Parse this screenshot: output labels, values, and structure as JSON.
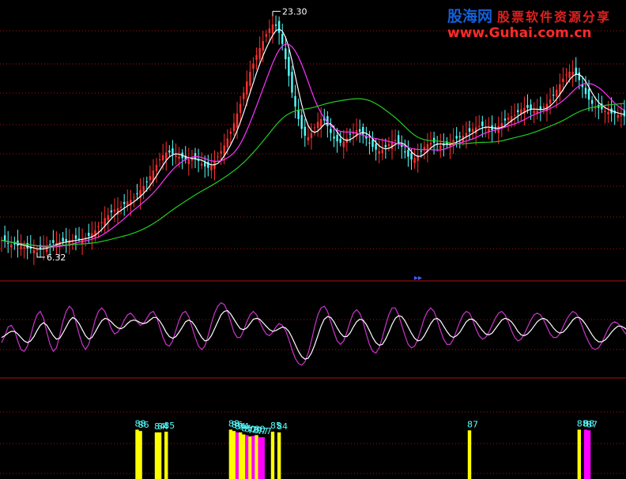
{
  "watermark": {
    "brand": "股海网",
    "tagline": "股票软件资源分享",
    "url": "www.Guhai.com.cn"
  },
  "colors": {
    "background": "#000000",
    "candle_up": "#ff3030",
    "candle_down": "#55ffff",
    "ma_short": "#ffffff",
    "ma_mid": "#ff33ff",
    "ma_long": "#22cc22",
    "kd_k": "#cc33cc",
    "kd_d": "#ffffff",
    "kd_j": "#ffff66",
    "divider": "#b01010",
    "grid_dots": "#b01010",
    "bar_yellow": "#ffff00",
    "bar_magenta": "#ff00ff",
    "bar_label": "#55ffff",
    "extreme_label": "#ffffff"
  },
  "chart_data": [
    {
      "type": "candlestick",
      "panel": "price",
      "x": [
        0,
        1,
        2,
        3,
        4,
        5,
        6,
        7,
        8,
        9,
        10,
        11,
        12,
        13,
        14,
        15,
        16,
        17,
        18,
        19,
        20,
        21,
        22,
        23,
        24,
        25,
        26,
        27,
        28,
        29,
        30,
        31,
        32,
        33,
        34,
        35,
        36,
        37,
        38,
        39,
        40,
        41,
        42,
        43,
        44,
        45,
        46,
        47,
        48,
        49,
        50,
        51,
        52,
        53,
        54,
        55,
        56,
        57,
        58,
        59,
        60,
        61,
        62,
        63,
        64,
        65,
        66,
        67,
        68,
        69,
        70,
        71,
        72,
        73,
        74,
        75,
        76,
        77,
        78,
        79,
        80,
        81,
        82,
        83,
        84,
        85,
        86,
        87,
        88,
        89,
        90,
        91,
        92,
        93,
        94,
        95,
        96,
        97,
        98,
        99,
        100,
        101,
        102,
        103,
        104,
        105,
        106,
        107,
        108,
        109,
        110,
        111,
        112,
        113,
        114,
        115,
        116,
        117,
        118,
        119,
        120,
        121,
        122,
        123,
        124,
        125,
        126,
        127,
        128,
        129,
        130,
        131,
        132,
        133,
        134,
        135,
        136,
        137,
        138,
        139,
        140,
        141,
        142,
        143,
        144,
        145,
        146,
        147,
        148,
        149,
        150,
        151,
        152,
        153,
        154,
        155,
        156,
        157,
        158,
        159,
        160,
        161,
        162,
        163,
        164,
        165,
        166,
        167,
        168,
        169,
        170,
        171,
        172,
        173,
        174,
        175,
        176,
        177,
        178,
        179,
        180,
        181,
        182,
        183,
        184,
        185,
        186,
        187,
        188,
        189,
        190,
        191,
        192,
        193,
        194,
        195,
        196,
        197
      ],
      "close": [
        7.2,
        7.1,
        7.0,
        6.9,
        6.9,
        6.8,
        6.8,
        6.7,
        6.6,
        6.6,
        6.5,
        6.5,
        6.6,
        6.7,
        6.8,
        6.9,
        7.0,
        7.0,
        7.1,
        7.1,
        7.1,
        7.2,
        7.2,
        7.3,
        7.3,
        7.3,
        7.4,
        7.5,
        7.7,
        7.9,
        8.2,
        8.5,
        8.8,
        9.0,
        9.2,
        9.4,
        9.5,
        9.6,
        9.8,
        10.0,
        10.1,
        10.3,
        10.5,
        10.8,
        11.1,
        11.4,
        11.8,
        12.2,
        12.6,
        13.0,
        13.3,
        13.5,
        13.5,
        13.4,
        13.3,
        13.2,
        13.1,
        13.0,
        13.0,
        13.1,
        13.0,
        12.9,
        12.7,
        12.5,
        12.4,
        12.6,
        12.9,
        13.2,
        13.6,
        14.0,
        14.5,
        15.0,
        15.6,
        16.3,
        17.0,
        17.8,
        18.6,
        19.3,
        19.9,
        20.5,
        21.0,
        21.5,
        22.0,
        22.4,
        22.7,
        22.6,
        22.1,
        21.3,
        20.2,
        19.0,
        17.8,
        16.8,
        15.9,
        15.2,
        14.7,
        14.6,
        14.9,
        15.3,
        15.7,
        15.9,
        15.8,
        15.4,
        14.9,
        14.5,
        14.3,
        14.2,
        14.3,
        14.5,
        14.8,
        15.0,
        15.1,
        15.0,
        14.8,
        14.5,
        14.2,
        13.9,
        13.7,
        13.6,
        13.7,
        13.9,
        14.1,
        14.3,
        14.4,
        14.2,
        13.9,
        13.5,
        13.2,
        13.0,
        13.1,
        13.3,
        13.6,
        13.9,
        14.1,
        14.2,
        14.2,
        14.1,
        14.0,
        14.0,
        14.1,
        14.2,
        14.4,
        14.5,
        14.6,
        14.7,
        14.9,
        15.0,
        15.2,
        15.3,
        15.4,
        15.4,
        15.3,
        15.2,
        15.1,
        15.2,
        15.4,
        15.6,
        15.8,
        16.0,
        16.1,
        16.2,
        16.4,
        16.6,
        16.7,
        16.7,
        16.6,
        16.5,
        16.5,
        16.6,
        16.8,
        17.0,
        17.3,
        17.6,
        18.0,
        18.4,
        18.8,
        19.1,
        19.3,
        19.3,
        19.1,
        18.7,
        18.2,
        17.7,
        17.3,
        17.0,
        16.8,
        16.7,
        16.6,
        16.5,
        16.4,
        16.3,
        16.3,
        16.2,
        16.2,
        16.1
      ],
      "annotations": [
        {
          "text": "23.30",
          "x": 84,
          "y": 23.3
        },
        {
          "text": "6.32",
          "x": 11,
          "y": 6.32
        }
      ],
      "ylim": [
        4.5,
        24.0
      ],
      "moving_averages": [
        "ma_short",
        "ma_mid",
        "ma_long"
      ]
    },
    {
      "type": "line",
      "panel": "oscillator",
      "x_count": 198,
      "series": [
        {
          "color_key": "kd_k",
          "values": [
            38,
            46,
            56,
            58,
            52,
            40,
            30,
            28,
            34,
            46,
            60,
            70,
            74,
            66,
            50,
            36,
            28,
            32,
            46,
            62,
            74,
            80,
            76,
            62,
            48,
            36,
            30,
            36,
            50,
            64,
            74,
            78,
            74,
            64,
            54,
            48,
            50,
            56,
            64,
            70,
            72,
            68,
            62,
            58,
            60,
            66,
            72,
            74,
            68,
            56,
            44,
            36,
            34,
            40,
            52,
            64,
            72,
            74,
            68,
            56,
            44,
            34,
            30,
            34,
            46,
            60,
            72,
            80,
            84,
            82,
            74,
            62,
            50,
            44,
            44,
            52,
            62,
            70,
            74,
            70,
            62,
            54,
            48,
            46,
            50,
            56,
            60,
            58,
            52,
            42,
            30,
            20,
            14,
            12,
            16,
            26,
            40,
            56,
            70,
            78,
            80,
            74,
            62,
            50,
            40,
            36,
            40,
            50,
            62,
            72,
            76,
            72,
            62,
            48,
            36,
            28,
            26,
            32,
            44,
            58,
            70,
            78,
            78,
            70,
            58,
            46,
            36,
            32,
            34,
            42,
            54,
            66,
            74,
            78,
            74,
            64,
            52,
            42,
            36,
            36,
            42,
            52,
            62,
            70,
            74,
            72,
            64,
            54,
            46,
            42,
            44,
            50,
            58,
            66,
            72,
            74,
            70,
            62,
            52,
            44,
            40,
            42,
            48,
            56,
            64,
            70,
            72,
            70,
            64,
            56,
            48,
            44,
            44,
            48,
            56,
            64,
            70,
            74,
            72,
            66,
            56,
            46,
            38,
            32,
            30,
            32,
            38,
            46,
            54,
            60,
            62,
            60,
            56,
            50,
            46,
            44,
            44,
            46
          ]
        },
        {
          "color_key": "kd_d",
          "values": [
            44,
            46,
            49,
            51,
            51,
            48,
            44,
            40,
            38,
            40,
            45,
            52,
            58,
            61,
            58,
            52,
            46,
            42,
            43,
            49,
            56,
            63,
            67,
            65,
            60,
            53,
            46,
            42,
            44,
            50,
            57,
            63,
            66,
            65,
            62,
            58,
            55,
            54,
            56,
            60,
            63,
            64,
            63,
            61,
            60,
            61,
            64,
            67,
            67,
            63,
            57,
            50,
            45,
            43,
            45,
            50,
            56,
            62,
            64,
            62,
            57,
            50,
            44,
            40,
            41,
            46,
            54,
            62,
            70,
            74,
            75,
            71,
            65,
            59,
            54,
            53,
            55,
            60,
            65,
            66,
            65,
            61,
            57,
            53,
            51,
            52,
            54,
            56,
            55,
            51,
            44,
            36,
            28,
            22,
            19,
            20,
            26,
            35,
            46,
            57,
            65,
            68,
            67,
            62,
            55,
            49,
            45,
            45,
            49,
            56,
            62,
            65,
            64,
            59,
            52,
            44,
            38,
            35,
            36,
            42,
            50,
            59,
            66,
            69,
            68,
            63,
            56,
            49,
            43,
            40,
            41,
            46,
            53,
            60,
            65,
            66,
            63,
            57,
            51,
            46,
            44,
            46,
            50,
            56,
            62,
            65,
            65,
            62,
            57,
            52,
            48,
            47,
            49,
            54,
            59,
            64,
            66,
            65,
            62,
            57,
            51,
            47,
            46,
            48,
            52,
            57,
            62,
            65,
            66,
            64,
            60,
            55,
            51,
            49,
            50,
            54,
            59,
            64,
            67,
            67,
            64,
            59,
            53,
            47,
            42,
            39,
            39,
            41,
            45,
            50,
            54,
            57,
            57,
            55,
            52,
            49,
            47,
            46
          ]
        }
      ],
      "ylim": [
        0,
        100
      ]
    },
    {
      "type": "bar",
      "panel": "signal",
      "x_count": 198,
      "bars": [
        {
          "x": 42,
          "value": 88,
          "color_key": "bar_yellow"
        },
        {
          "x": 43,
          "value": 86,
          "color_key": "bar_yellow"
        },
        {
          "x": 48,
          "value": 84,
          "color_key": "bar_yellow"
        },
        {
          "x": 49,
          "value": 84,
          "color_key": "bar_yellow"
        },
        {
          "x": 51,
          "value": 85,
          "color_key": "bar_yellow"
        },
        {
          "x": 71,
          "value": 88,
          "color_key": "bar_yellow"
        },
        {
          "x": 72,
          "value": 86,
          "color_key": "bar_yellow"
        },
        {
          "x": 73,
          "value": 84,
          "color_key": "bar_magenta"
        },
        {
          "x": 74,
          "value": 84,
          "color_key": "bar_yellow"
        },
        {
          "x": 75,
          "value": 81,
          "color_key": "bar_yellow"
        },
        {
          "x": 76,
          "value": 80,
          "color_key": "bar_magenta"
        },
        {
          "x": 77,
          "value": 78,
          "color_key": "bar_yellow"
        },
        {
          "x": 78,
          "value": 79,
          "color_key": "bar_magenta"
        },
        {
          "x": 79,
          "value": 80,
          "color_key": "bar_yellow"
        },
        {
          "x": 80,
          "value": 77,
          "color_key": "bar_magenta"
        },
        {
          "x": 81,
          "value": 77,
          "color_key": "bar_magenta"
        },
        {
          "x": 84,
          "value": 85,
          "color_key": "bar_yellow"
        },
        {
          "x": 86,
          "value": 84,
          "color_key": "bar_yellow"
        },
        {
          "x": 145,
          "value": 87,
          "color_key": "bar_yellow"
        },
        {
          "x": 179,
          "value": 88,
          "color_key": "bar_yellow"
        },
        {
          "x": 181,
          "value": 88,
          "color_key": "bar_magenta"
        },
        {
          "x": 182,
          "value": 87,
          "color_key": "bar_magenta"
        }
      ],
      "ylim": [
        0,
        100
      ]
    }
  ]
}
